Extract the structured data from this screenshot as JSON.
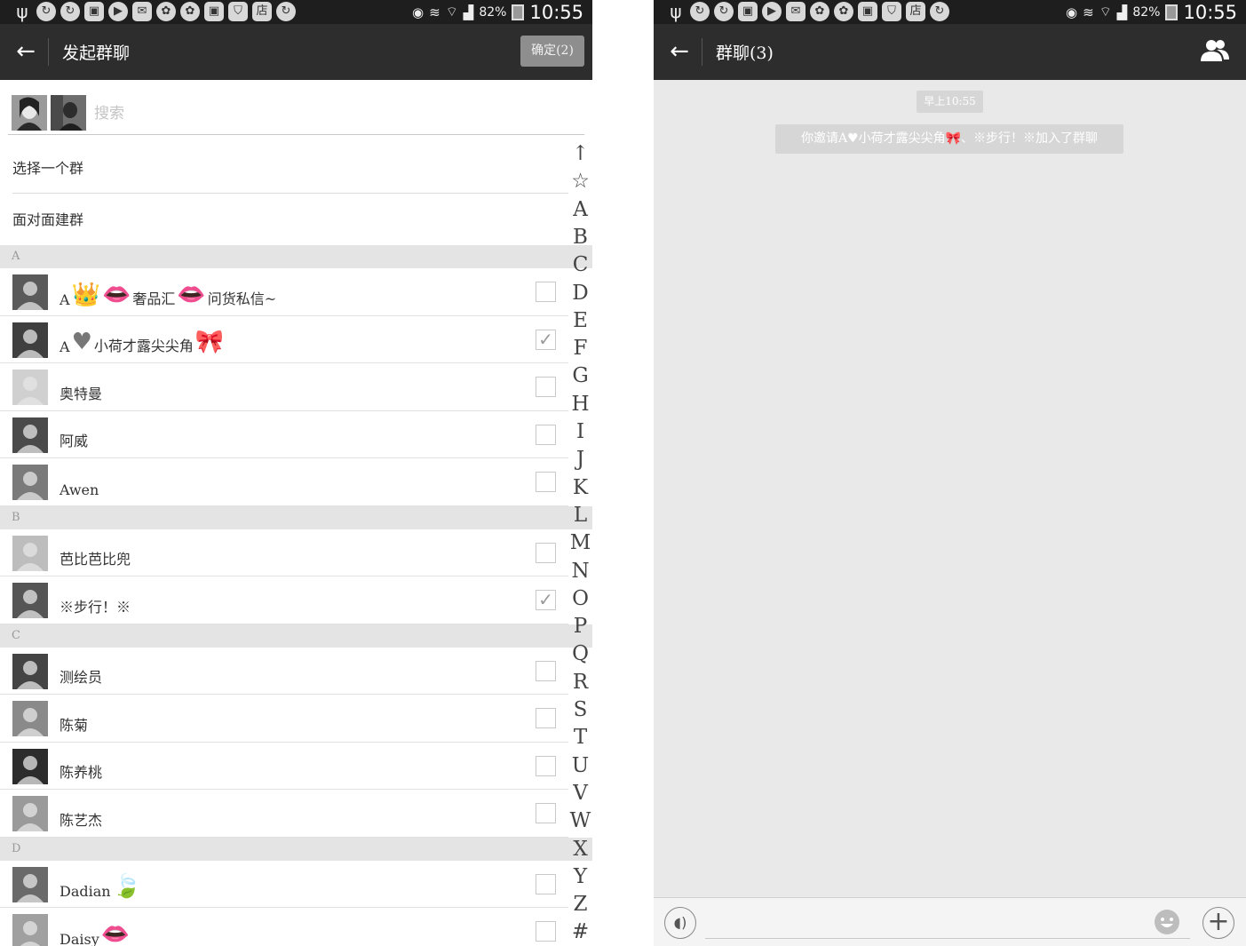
{
  "status_bar": {
    "battery_text": "82%",
    "time": "10:55",
    "notification_icons": [
      "usb-icon",
      "sync-icon",
      "app-icon",
      "gallery-icon",
      "play-icon",
      "mail-icon",
      "wechat-icon",
      "wechat-icon",
      "gallery-icon",
      "shield-icon",
      "store-icon",
      "sync-icon"
    ],
    "store_glyph": "店"
  },
  "left": {
    "header": {
      "title": "发起群聊",
      "confirm_label": "确定(2)"
    },
    "search": {
      "placeholder": "搜索"
    },
    "menu": {
      "select_group": "选择一个群",
      "face_to_face": "面对面建群"
    },
    "sections": [
      {
        "letter": "A",
        "contacts": [
          {
            "name_parts": [
              "A",
              "👑",
              "👄",
              "奢品汇",
              "👄",
              "问货私信~"
            ],
            "checked": false,
            "avatar_tone": "#5a5a5a"
          },
          {
            "name_parts": [
              "A",
              "♥",
              "小荷才露尖尖角",
              "🎀"
            ],
            "checked": true,
            "avatar_tone": "#3f3f3f"
          },
          {
            "name_parts": [
              "奥特曼"
            ],
            "checked": false,
            "avatar_tone": "#d0d0d0"
          },
          {
            "name_parts": [
              "阿威"
            ],
            "checked": false,
            "avatar_tone": "#4a4a4a"
          },
          {
            "name_parts": [
              "Awen"
            ],
            "checked": false,
            "avatar_tone": "#7a7a7a"
          }
        ]
      },
      {
        "letter": "B",
        "contacts": [
          {
            "name_parts": [
              "芭比芭比兜"
            ],
            "checked": false,
            "avatar_tone": "#bdbdbd"
          },
          {
            "name_parts": [
              "※步行！※"
            ],
            "checked": true,
            "avatar_tone": "#555555"
          }
        ]
      },
      {
        "letter": "C",
        "contacts": [
          {
            "name_parts": [
              "测绘员"
            ],
            "checked": false,
            "avatar_tone": "#444444"
          },
          {
            "name_parts": [
              "陈菊"
            ],
            "checked": false,
            "avatar_tone": "#8a8a8a"
          },
          {
            "name_parts": [
              "陈养桃"
            ],
            "checked": false,
            "avatar_tone": "#2c2c2c"
          },
          {
            "name_parts": [
              "陈艺杰"
            ],
            "checked": false,
            "avatar_tone": "#9a9a9a"
          }
        ]
      },
      {
        "letter": "D",
        "contacts": [
          {
            "name_parts": [
              "Dadian",
              "🍃"
            ],
            "checked": false,
            "avatar_tone": "#6a6a6a"
          },
          {
            "name_parts": [
              "Daisy",
              "👄"
            ],
            "checked": false,
            "avatar_tone": "#a0a0a0"
          }
        ]
      }
    ],
    "index_letters": [
      "↑",
      "☆",
      "A",
      "B",
      "C",
      "D",
      "E",
      "F",
      "G",
      "H",
      "I",
      "J",
      "K",
      "L",
      "M",
      "N",
      "O",
      "P",
      "Q",
      "R",
      "S",
      "T",
      "U",
      "V",
      "W",
      "X",
      "Y",
      "Z",
      "#"
    ]
  },
  "right": {
    "header": {
      "title": "群聊(3)"
    },
    "time_badge": "早上10:55",
    "system_message": "你邀请A♥小荷才露尖尖角🎀、※步行！※加入了群聊"
  }
}
